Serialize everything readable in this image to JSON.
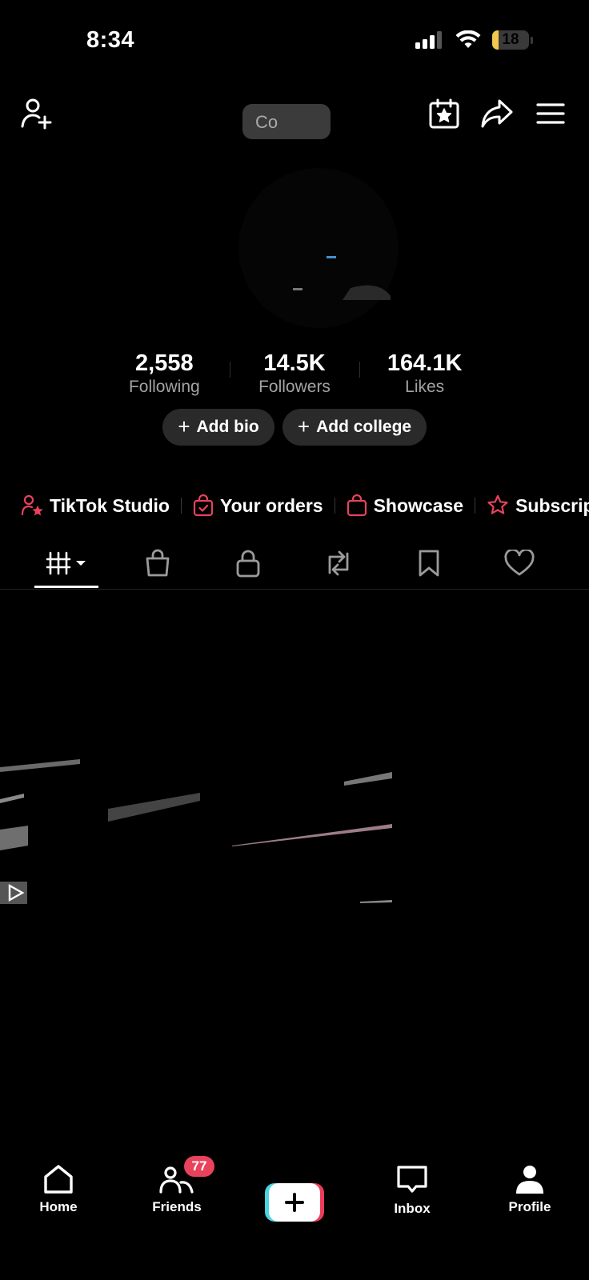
{
  "status_bar": {
    "time": "8:34",
    "battery": "18",
    "battery_fraction": 0.18
  },
  "header": {
    "username_partial": "Co"
  },
  "stats": [
    {
      "value": "2,558",
      "label": "Following"
    },
    {
      "value": "14.5K",
      "label": "Followers"
    },
    {
      "value": "164.1K",
      "label": "Likes"
    }
  ],
  "actions": {
    "add_bio": "Add bio",
    "add_college": "Add college",
    "plus": "+"
  },
  "shortcuts": [
    {
      "label": "TikTok Studio",
      "icon": "person-star-icon"
    },
    {
      "label": "Your orders",
      "icon": "bag-check-icon"
    },
    {
      "label": "Showcase",
      "icon": "shopping-bag-icon"
    },
    {
      "label": "Subscrip",
      "icon": "star-outline-icon"
    }
  ],
  "tabs": [
    "videos-grid",
    "shop",
    "private",
    "reposts",
    "favorites",
    "liked"
  ],
  "nav": {
    "home": "Home",
    "friends": "Friends",
    "friends_badge": "77",
    "inbox": "Inbox",
    "profile": "Profile"
  },
  "colors": {
    "accent": "#e9425c",
    "cyan": "#48d4e0",
    "pill_bg": "#2a2a2a"
  }
}
